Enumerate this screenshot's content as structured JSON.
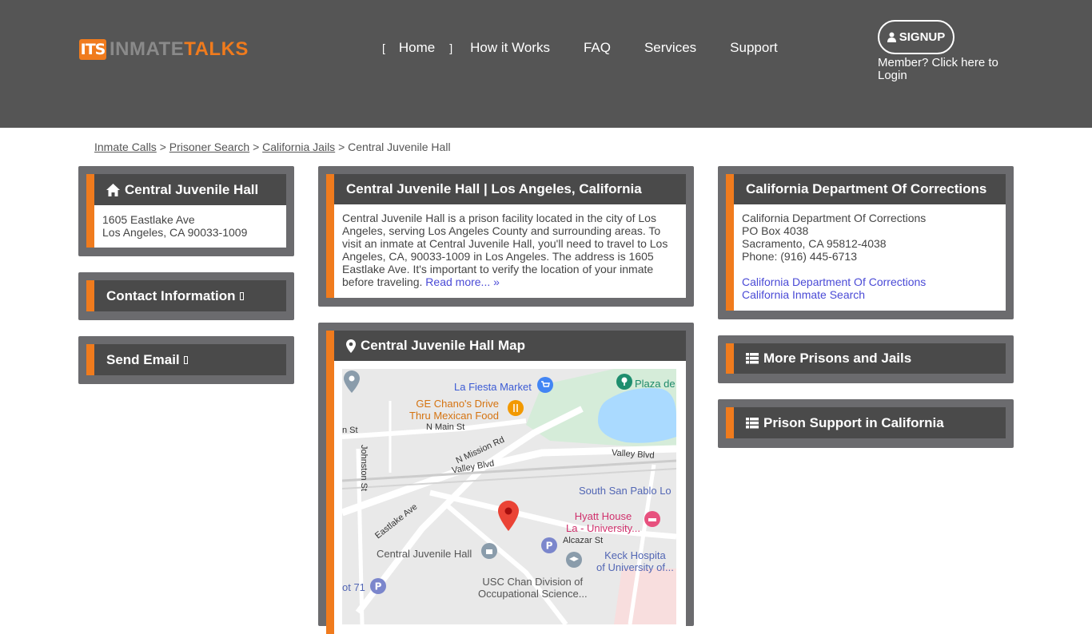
{
  "header": {
    "logo_mark": "ITS",
    "logo_part1": "INMATE",
    "logo_part2": "TALKS",
    "nav": [
      "Home",
      "How it Works",
      "FAQ",
      "Services",
      "Support"
    ],
    "nav_bracket_left": "[",
    "nav_bracket_right": "]",
    "signup_label": "SIGNUP",
    "login_text": "Member? Click here to Login"
  },
  "breadcrumb": {
    "items": [
      "Inmate Calls",
      "Prisoner Search",
      "California Jails"
    ],
    "separator": ">",
    "current": "Central Juvenile Hall"
  },
  "left": {
    "facility_title": "Central Juvenile Hall",
    "address_line1": "1605 Eastlake Ave",
    "address_line2": "Los Angeles, CA 90033-1009",
    "contact_title": "Contact Information",
    "email_title": "Send Email"
  },
  "middle": {
    "info_title": "Central Juvenile Hall | Los Angeles, California",
    "info_text": "Central Juvenile Hall is a prison facility located in the city of Los Angeles, serving Los Angeles County and surrounding areas. To visit an inmate at Central Juvenile Hall, you'll need to travel to Los Angeles, CA, 90033-1009 in Los Angeles. The address is 1605 Eastlake Ave. It's important to verify the location of your inmate before traveling.",
    "read_more": "Read more... »",
    "map_title": "Central Juvenile Hall Map",
    "map_labels": {
      "la_fiesta": "La Fiesta Market",
      "chanos1": "GE Chano's Drive",
      "chanos2": "Thru Mexican Food",
      "plaza": "Plaza de",
      "n_main": "N Main St",
      "n_st": "n St",
      "johnston": "Johnston St",
      "mission": "N Mission Rd",
      "valley1": "Valley Blvd",
      "valley2": "Valley Blvd",
      "south_san_pablo": "South San Pablo Lo",
      "hyatt1": "Hyatt House",
      "hyatt2": "La - University...",
      "eastlake": "Eastlake Ave",
      "alcazar": "Alcazar St",
      "cjh": "Central Juvenile Hall",
      "keck1": "Keck Hospita",
      "keck2": "of University of...",
      "usc1": "USC Chan Division of",
      "usc2": "Occupational Science...",
      "lot71": "ot 71"
    }
  },
  "right": {
    "dept_title": "California Department Of Corrections",
    "dept_lines": [
      "California Department Of Corrections",
      "PO Box 4038",
      "Sacramento, CA 95812-4038",
      "Phone: (916) 445-6713"
    ],
    "dept_link1": "California Department Of Corrections",
    "dept_link2": "California Inmate Search",
    "more_title": "More Prisons and Jails",
    "support_title": "Prison Support in California"
  },
  "colors": {
    "accent": "#f07b1d",
    "header_bg": "#555555",
    "panel_bg": "#6b6b6e",
    "panel_head": "#4a4a4a",
    "link": "#4a4ad6"
  }
}
